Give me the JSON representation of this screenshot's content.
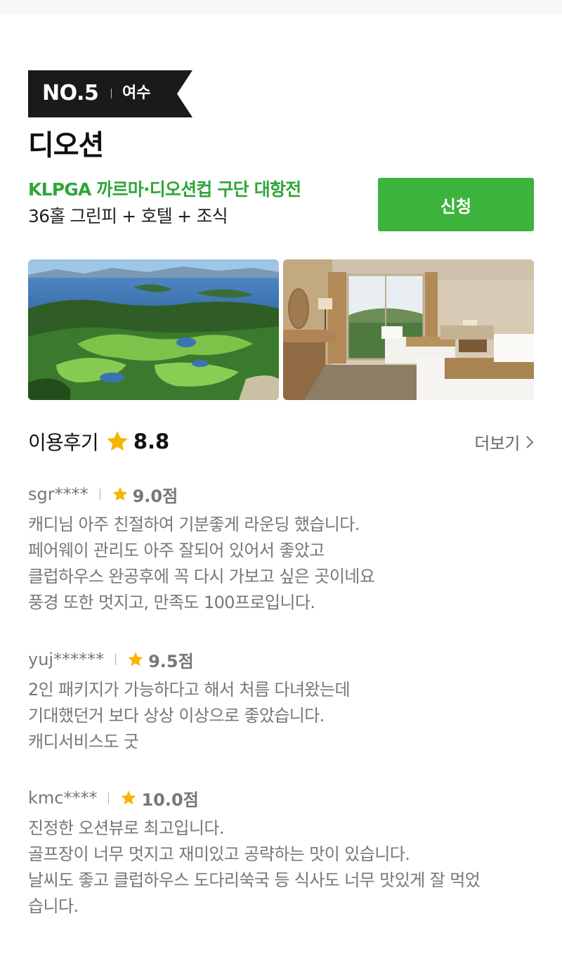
{
  "header": {
    "rank": "NO.5",
    "region": "여수"
  },
  "course": {
    "name": "디오션",
    "event": "KLPGA 까르마·디오션컵 구단 대항전",
    "package": "36홀 그린피 + 호텔 + 조식",
    "apply_label": "신청",
    "brand_color": "#3bb33c"
  },
  "photos": [
    {
      "icon": "golf-course-aerial-photo"
    },
    {
      "icon": "hotel-room-photo"
    }
  ],
  "reviews_section": {
    "title": "이용후기",
    "average_score": "8.8",
    "more_label": "더보기",
    "star_color": "#f8b500"
  },
  "reviews": [
    {
      "user": "sgr****",
      "score": "9.0점",
      "lines": [
        "캐디님 아주 친절하여 기분좋게 라운딩 했습니다.",
        "페어웨이 관리도 아주 잘되어 있어서 좋았고",
        "클럽하우스 완공후에 꼭 다시 가보고 싶은 곳이네요",
        "풍경 또한 멋지고, 만족도 100프로입니다."
      ]
    },
    {
      "user": "yuj******",
      "score": "9.5점",
      "lines": [
        "2인 패키지가 가능하다고 해서 처름 다녀왔는데",
        "기대했던거 보다 상상 이상으로 좋았습니다.",
        "캐디서비스도 굿"
      ]
    },
    {
      "user": "kmc****",
      "score": "10.0점",
      "lines": [
        "진정한 오션뷰로 최고입니다.",
        "골프장이 너무 멋지고 재미있고 공략하는 맛이 있습니다.",
        "날씨도 좋고 클럽하우스 도다리쑥국 등 식사도 너무 맛있게 잘 먹었",
        "습니다."
      ]
    }
  ]
}
